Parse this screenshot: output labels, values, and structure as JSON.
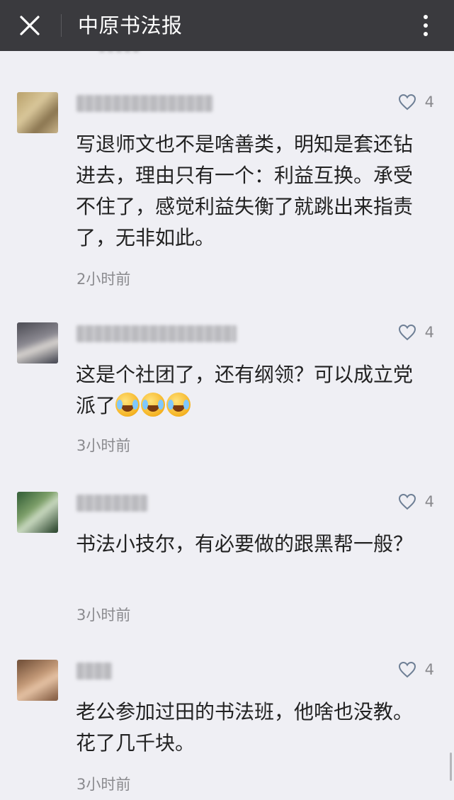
{
  "header": {
    "title": "中原书法报",
    "close_icon": "close-icon",
    "more_icon": "more-vertical-icon"
  },
  "comments": [
    {
      "avatar_icon": "avatar-blurred",
      "like_count": "4",
      "text": "写退师文也不是啥善类，明知是套还钻进去，理由只有一个：利益互换。承受不住了，感觉利益失衡了就跳出来指责了，无非如此。",
      "time": "2小时前"
    },
    {
      "avatar_icon": "avatar-blurred",
      "like_count": "4",
      "text": "这是个社团了，还有纲领？可以成立党派了",
      "emoji_icon": "crying-laughing-emoji",
      "time": "3小时前"
    },
    {
      "avatar_icon": "avatar-blurred",
      "like_count": "4",
      "text": "书法小技尔，有必要做的跟黑帮一般？",
      "time": "3小时前"
    },
    {
      "avatar_icon": "avatar-blurred",
      "like_count": "4",
      "text": "老公参加过田的书法班，他啥也没教。花了几千块。",
      "time": "3小时前"
    }
  ],
  "colors": {
    "header_bg": "#3a3a3e",
    "page_bg": "#efeff4",
    "text": "#222222",
    "meta": "#8a8a8e"
  }
}
